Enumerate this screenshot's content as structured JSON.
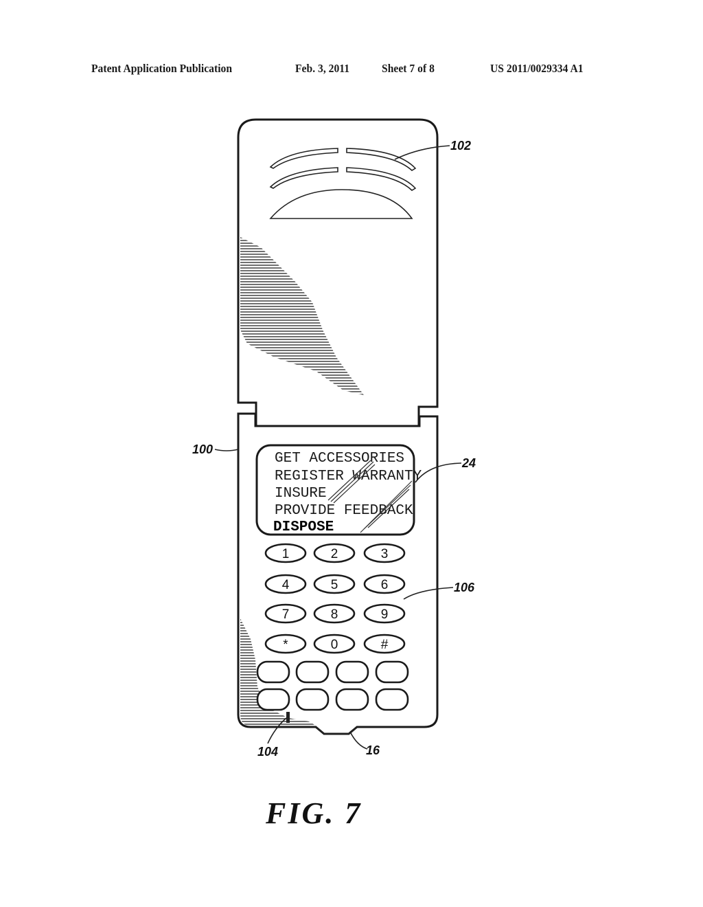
{
  "header": {
    "publication_type": "Patent Application Publication",
    "date": "Feb. 3, 2011",
    "sheet": "Sheet 7 of 8",
    "publication_number": "US 2011/0029334 A1"
  },
  "figure": {
    "caption": "FIG. 7",
    "reference_labels": {
      "flip_lid_speaker": "102",
      "phone_body": "100",
      "display": "24",
      "keypad": "106",
      "microphone": "104",
      "connector": "16"
    },
    "display_menu": [
      {
        "label": "GET ACCESSORIES",
        "selected": false
      },
      {
        "label": "REGISTER WARRANTY",
        "selected": false
      },
      {
        "label": "INSURE",
        "selected": false
      },
      {
        "label": "PROVIDE FEEDBACK",
        "selected": false
      },
      {
        "label": "DISPOSE",
        "selected": true
      }
    ],
    "keypad_keys": [
      "1",
      "2",
      "3",
      "4",
      "5",
      "6",
      "7",
      "8",
      "9",
      "*",
      "0",
      "#"
    ],
    "function_key_count": 8
  }
}
